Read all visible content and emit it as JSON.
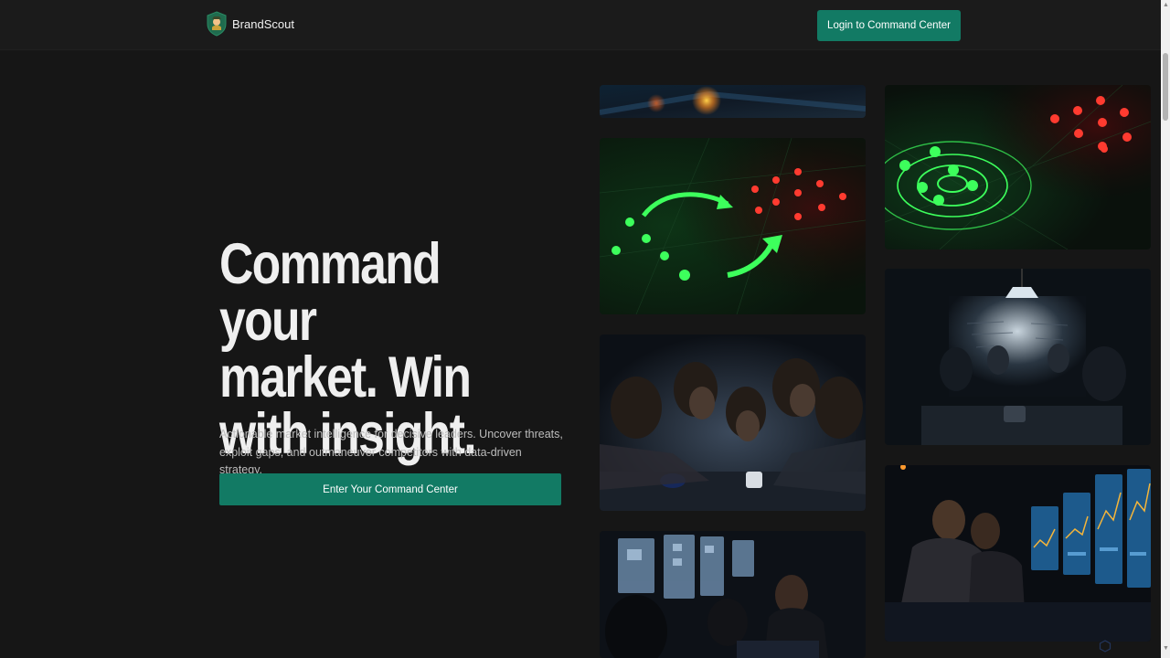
{
  "header": {
    "brand_name": "BrandScout",
    "login_label": "Login to Command Center"
  },
  "hero": {
    "title": "Command your\nmarket. Win\nwith insight.",
    "subtitle": "Actionable market intelligence for decisive leaders. Uncover threats, exploit gaps, and outmaneuver competitors with data-driven strategy.",
    "cta_label": "Enter Your Command Center"
  },
  "gallery": {
    "images": [
      {
        "name": "bokeh-lights-image"
      },
      {
        "name": "strategy-arrows-image"
      },
      {
        "name": "team-huddle-image"
      },
      {
        "name": "dark-office-image"
      },
      {
        "name": "radar-targets-image"
      },
      {
        "name": "whiteboard-meeting-image"
      },
      {
        "name": "trading-screens-image"
      }
    ]
  },
  "colors": {
    "accent": "#127a64",
    "background": "#161616",
    "header": "#1b1b1b",
    "green_dot": "#3dff5c",
    "red_dot": "#ff3b30"
  }
}
